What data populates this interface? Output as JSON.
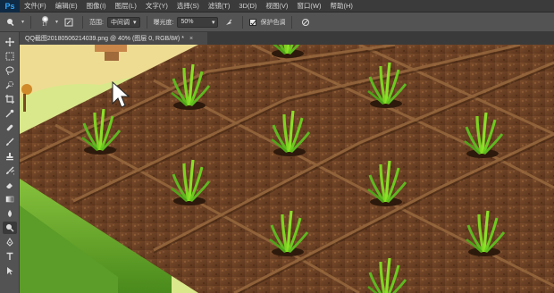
{
  "app": {
    "logo": "Ps"
  },
  "menu": [
    {
      "id": "file",
      "label": "文件(F)"
    },
    {
      "id": "edit",
      "label": "编辑(E)"
    },
    {
      "id": "image",
      "label": "图像(I)"
    },
    {
      "id": "layer",
      "label": "图层(L)"
    },
    {
      "id": "type",
      "label": "文字(Y)"
    },
    {
      "id": "select",
      "label": "选择(S)"
    },
    {
      "id": "filter",
      "label": "滤镜(T)"
    },
    {
      "id": "3d",
      "label": "3D(D)"
    },
    {
      "id": "view",
      "label": "视图(V)"
    },
    {
      "id": "window",
      "label": "窗口(W)"
    },
    {
      "id": "help",
      "label": "帮助(H)"
    }
  ],
  "options": {
    "brush_size": "17",
    "range_label": "范围:",
    "range_value": "中间调",
    "exposure_label": "曝光度:",
    "exposure_value": "50%",
    "protect_tones_label": "保护色调",
    "protect_tones_checked": true
  },
  "document": {
    "tab_title": "QQ截图20180506214039.png @ 40% (图层 0, RGB/8#) *",
    "close_symbol": "×"
  },
  "tools": [
    "move-icon",
    "marquee-icon",
    "lasso-icon",
    "quick-select-icon",
    "crop-icon",
    "eyedropper-icon",
    "healing-icon",
    "brush-icon",
    "clone-stamp-icon",
    "history-brush-icon",
    "eraser-icon",
    "gradient-icon",
    "blur-icon",
    "dodge-icon",
    "pen-icon",
    "type-icon",
    "path-select-icon"
  ],
  "active_tool": "dodge-icon",
  "colors": {
    "soil": "#6b4226",
    "soil_dark": "#4a2c18",
    "grass": "#5a9a2a",
    "sprout": "#7ed321",
    "path": "#f2e6a8"
  }
}
